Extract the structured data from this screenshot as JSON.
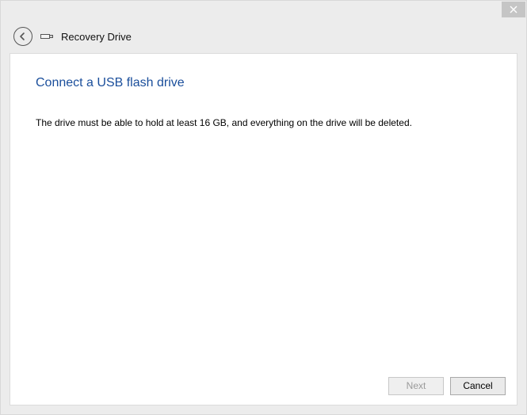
{
  "window": {
    "title": "Recovery Drive"
  },
  "content": {
    "heading": "Connect a USB flash drive",
    "body": "The drive must be able to hold at least 16 GB, and everything on the drive will be deleted."
  },
  "buttons": {
    "next": "Next",
    "cancel": "Cancel"
  }
}
